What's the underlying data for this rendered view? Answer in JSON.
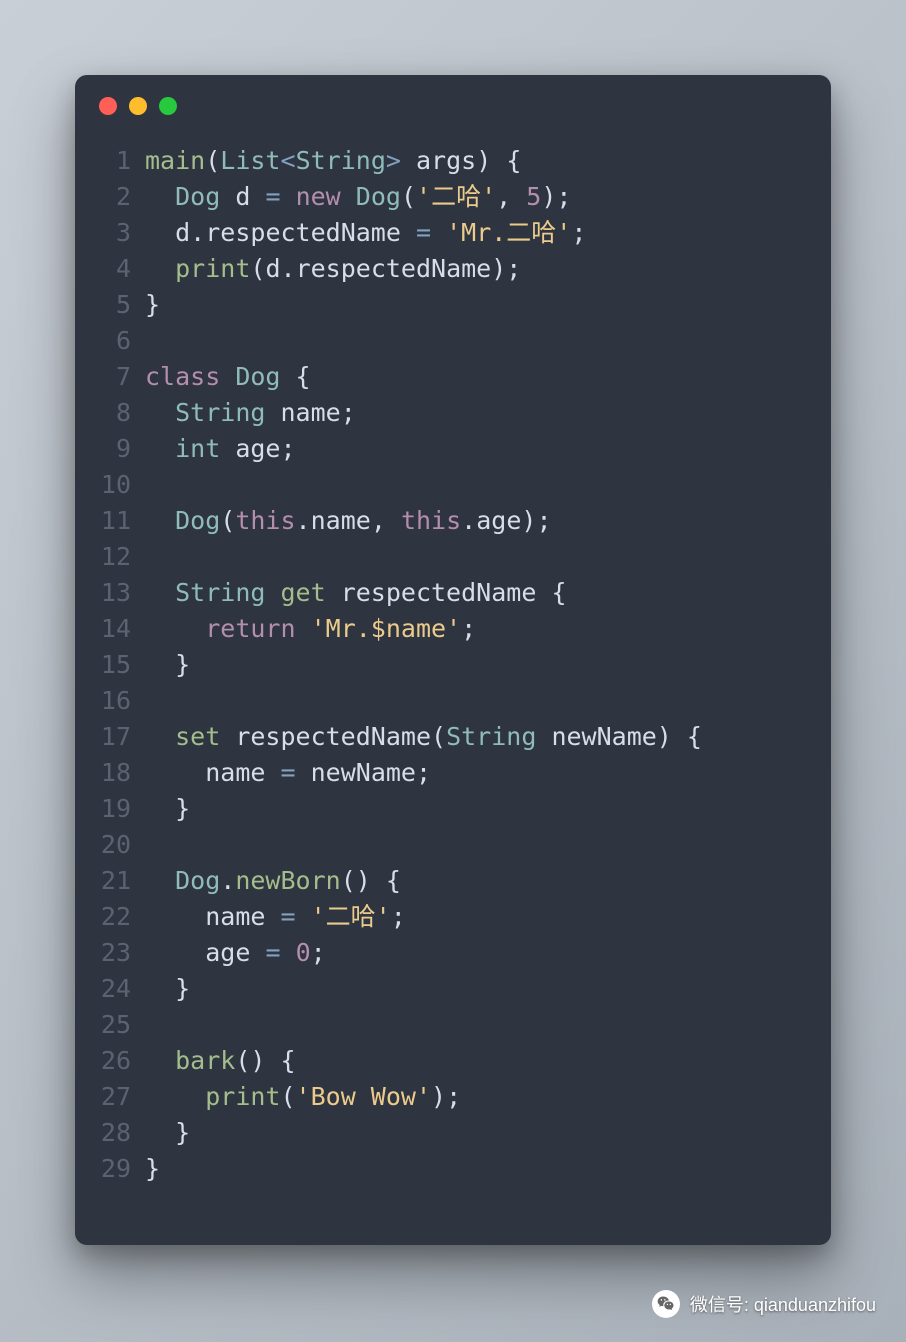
{
  "window": {
    "dots": [
      "red",
      "yellow",
      "green"
    ]
  },
  "code": {
    "lines": [
      {
        "n": "1",
        "tokens": [
          [
            "main",
            "ident"
          ],
          [
            "(",
            "punc"
          ],
          [
            "List",
            "type"
          ],
          [
            "<",
            "op"
          ],
          [
            "String",
            "type"
          ],
          [
            ">",
            "op"
          ],
          [
            " ",
            "plain"
          ],
          [
            "args",
            "plain"
          ],
          [
            ")",
            "punc"
          ],
          [
            " ",
            "plain"
          ],
          [
            "{",
            "punc"
          ]
        ]
      },
      {
        "n": "2",
        "tokens": [
          [
            "  ",
            "plain"
          ],
          [
            "Dog",
            "type"
          ],
          [
            " ",
            "plain"
          ],
          [
            "d",
            "plain"
          ],
          [
            " ",
            "plain"
          ],
          [
            "=",
            "op"
          ],
          [
            " ",
            "plain"
          ],
          [
            "new",
            "keyword"
          ],
          [
            " ",
            "plain"
          ],
          [
            "Dog",
            "type"
          ],
          [
            "(",
            "punc"
          ],
          [
            "'二哈'",
            "string"
          ],
          [
            ",",
            "punc"
          ],
          [
            " ",
            "plain"
          ],
          [
            "5",
            "number"
          ],
          [
            ")",
            "punc"
          ],
          [
            ";",
            "punc"
          ]
        ]
      },
      {
        "n": "3",
        "tokens": [
          [
            "  ",
            "plain"
          ],
          [
            "d",
            "plain"
          ],
          [
            ".",
            "punc"
          ],
          [
            "respectedName",
            "plain"
          ],
          [
            " ",
            "plain"
          ],
          [
            "=",
            "op"
          ],
          [
            " ",
            "plain"
          ],
          [
            "'Mr.二哈'",
            "string"
          ],
          [
            ";",
            "punc"
          ]
        ]
      },
      {
        "n": "4",
        "tokens": [
          [
            "  ",
            "plain"
          ],
          [
            "print",
            "ident"
          ],
          [
            "(",
            "punc"
          ],
          [
            "d",
            "plain"
          ],
          [
            ".",
            "punc"
          ],
          [
            "respectedName",
            "plain"
          ],
          [
            ")",
            "punc"
          ],
          [
            ";",
            "punc"
          ]
        ]
      },
      {
        "n": "5",
        "tokens": [
          [
            "}",
            "punc"
          ]
        ]
      },
      {
        "n": "6",
        "tokens": []
      },
      {
        "n": "7",
        "tokens": [
          [
            "class",
            "keyword"
          ],
          [
            " ",
            "plain"
          ],
          [
            "Dog",
            "type"
          ],
          [
            " ",
            "plain"
          ],
          [
            "{",
            "punc"
          ]
        ]
      },
      {
        "n": "8",
        "tokens": [
          [
            "  ",
            "plain"
          ],
          [
            "String",
            "type"
          ],
          [
            " ",
            "plain"
          ],
          [
            "name",
            "plain"
          ],
          [
            ";",
            "punc"
          ]
        ]
      },
      {
        "n": "9",
        "tokens": [
          [
            "  ",
            "plain"
          ],
          [
            "int",
            "type"
          ],
          [
            " ",
            "plain"
          ],
          [
            "age",
            "plain"
          ],
          [
            ";",
            "punc"
          ]
        ]
      },
      {
        "n": "10",
        "tokens": []
      },
      {
        "n": "11",
        "tokens": [
          [
            "  ",
            "plain"
          ],
          [
            "Dog",
            "type"
          ],
          [
            "(",
            "punc"
          ],
          [
            "this",
            "keyword"
          ],
          [
            ".",
            "punc"
          ],
          [
            "name",
            "plain"
          ],
          [
            ",",
            "punc"
          ],
          [
            " ",
            "plain"
          ],
          [
            "this",
            "keyword"
          ],
          [
            ".",
            "punc"
          ],
          [
            "age",
            "plain"
          ],
          [
            ")",
            "punc"
          ],
          [
            ";",
            "punc"
          ]
        ]
      },
      {
        "n": "12",
        "tokens": []
      },
      {
        "n": "13",
        "tokens": [
          [
            "  ",
            "plain"
          ],
          [
            "String",
            "type"
          ],
          [
            " ",
            "plain"
          ],
          [
            "get",
            "ident"
          ],
          [
            " ",
            "plain"
          ],
          [
            "respectedName",
            "plain"
          ],
          [
            " ",
            "plain"
          ],
          [
            "{",
            "punc"
          ]
        ]
      },
      {
        "n": "14",
        "tokens": [
          [
            "    ",
            "plain"
          ],
          [
            "return",
            "keyword"
          ],
          [
            " ",
            "plain"
          ],
          [
            "'Mr.$name'",
            "string"
          ],
          [
            ";",
            "punc"
          ]
        ]
      },
      {
        "n": "15",
        "tokens": [
          [
            "  ",
            "plain"
          ],
          [
            "}",
            "punc"
          ]
        ]
      },
      {
        "n": "16",
        "tokens": []
      },
      {
        "n": "17",
        "tokens": [
          [
            "  ",
            "plain"
          ],
          [
            "set",
            "ident"
          ],
          [
            " ",
            "plain"
          ],
          [
            "respectedName",
            "plain"
          ],
          [
            "(",
            "punc"
          ],
          [
            "String",
            "type"
          ],
          [
            " ",
            "plain"
          ],
          [
            "newName",
            "plain"
          ],
          [
            ")",
            "punc"
          ],
          [
            " ",
            "plain"
          ],
          [
            "{",
            "punc"
          ]
        ]
      },
      {
        "n": "18",
        "tokens": [
          [
            "    ",
            "plain"
          ],
          [
            "name",
            "plain"
          ],
          [
            " ",
            "plain"
          ],
          [
            "=",
            "op"
          ],
          [
            " ",
            "plain"
          ],
          [
            "newName",
            "plain"
          ],
          [
            ";",
            "punc"
          ]
        ]
      },
      {
        "n": "19",
        "tokens": [
          [
            "  ",
            "plain"
          ],
          [
            "}",
            "punc"
          ]
        ]
      },
      {
        "n": "20",
        "tokens": []
      },
      {
        "n": "21",
        "tokens": [
          [
            "  ",
            "plain"
          ],
          [
            "Dog",
            "type"
          ],
          [
            ".",
            "punc"
          ],
          [
            "newBorn",
            "ident"
          ],
          [
            "(",
            "punc"
          ],
          [
            ")",
            "punc"
          ],
          [
            " ",
            "plain"
          ],
          [
            "{",
            "punc"
          ]
        ]
      },
      {
        "n": "22",
        "tokens": [
          [
            "    ",
            "plain"
          ],
          [
            "name",
            "plain"
          ],
          [
            " ",
            "plain"
          ],
          [
            "=",
            "op"
          ],
          [
            " ",
            "plain"
          ],
          [
            "'二哈'",
            "string"
          ],
          [
            ";",
            "punc"
          ]
        ]
      },
      {
        "n": "23",
        "tokens": [
          [
            "    ",
            "plain"
          ],
          [
            "age",
            "plain"
          ],
          [
            " ",
            "plain"
          ],
          [
            "=",
            "op"
          ],
          [
            " ",
            "plain"
          ],
          [
            "0",
            "number"
          ],
          [
            ";",
            "punc"
          ]
        ]
      },
      {
        "n": "24",
        "tokens": [
          [
            "  ",
            "plain"
          ],
          [
            "}",
            "punc"
          ]
        ]
      },
      {
        "n": "25",
        "tokens": []
      },
      {
        "n": "26",
        "tokens": [
          [
            "  ",
            "plain"
          ],
          [
            "bark",
            "ident"
          ],
          [
            "(",
            "punc"
          ],
          [
            ")",
            "punc"
          ],
          [
            " ",
            "plain"
          ],
          [
            "{",
            "punc"
          ]
        ]
      },
      {
        "n": "27",
        "tokens": [
          [
            "    ",
            "plain"
          ],
          [
            "print",
            "ident"
          ],
          [
            "(",
            "punc"
          ],
          [
            "'Bow Wow'",
            "string"
          ],
          [
            ")",
            "punc"
          ],
          [
            ";",
            "punc"
          ]
        ]
      },
      {
        "n": "28",
        "tokens": [
          [
            "  ",
            "plain"
          ],
          [
            "}",
            "punc"
          ]
        ]
      },
      {
        "n": "29",
        "tokens": [
          [
            "}",
            "punc"
          ]
        ]
      }
    ]
  },
  "footer": {
    "label": "微信号: qianduanzhifou"
  }
}
